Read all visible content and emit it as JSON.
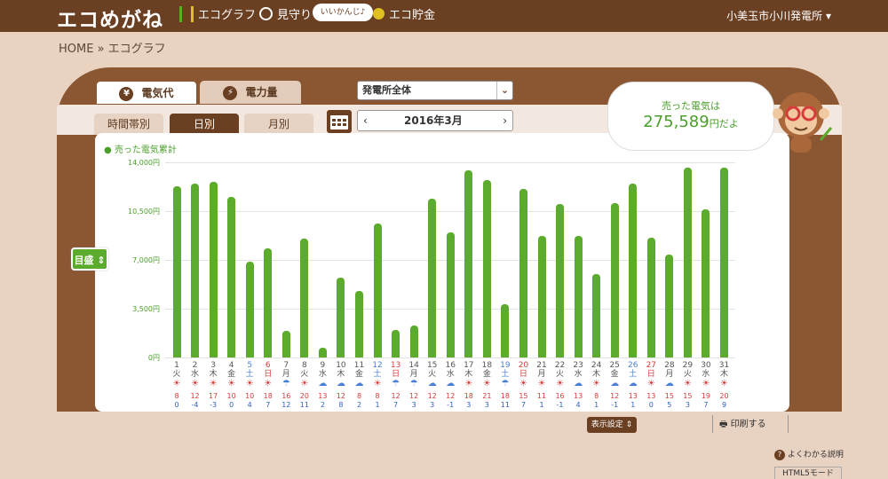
{
  "header": {
    "logo": "エコめがね",
    "nav": [
      "エコグラフ",
      "見守り",
      "エコ貯金"
    ],
    "bubble": "いいかんじ♪",
    "location": "小美玉市小川発電所 ▾"
  },
  "breadcrumb": "HOME » エコグラフ",
  "tabs": {
    "money": "電気代",
    "power": "電力量",
    "money_icon": "¥",
    "power_icon": "⚡"
  },
  "plant_select": "発電所全体",
  "subtabs": [
    "時間帯別",
    "日別",
    "月別"
  ],
  "month_label": "2016年3月",
  "savings": {
    "label": "売った電気は",
    "value": "275,589",
    "suffix": "円だよ"
  },
  "legend": "売った電気累計",
  "scale_button": "目盛 ⇕",
  "display_settings": "表示設定 ⇕",
  "print": "印刷する",
  "help": "よくわかる説明",
  "html5": "HTML5モード",
  "colors": {
    "bar": "#5bab2c",
    "header": "#6b3f22",
    "sunday": "#d93b3b",
    "saturday": "#4a80d8"
  },
  "chart_data": {
    "type": "bar",
    "title": "",
    "ylabel": "",
    "ylim": [
      0,
      14000
    ],
    "yticks": [
      "0円",
      "3,500円",
      "7,000円",
      "10,500円",
      "14,000円"
    ],
    "categories": [
      "1",
      "2",
      "3",
      "4",
      "5",
      "6",
      "7",
      "8",
      "9",
      "10",
      "11",
      "12",
      "13",
      "14",
      "15",
      "16",
      "17",
      "18",
      "19",
      "20",
      "21",
      "22",
      "23",
      "24",
      "25",
      "26",
      "27",
      "28",
      "29",
      "30",
      "31"
    ],
    "weekdays": [
      "火",
      "水",
      "木",
      "金",
      "土",
      "日",
      "月",
      "火",
      "水",
      "木",
      "金",
      "土",
      "日",
      "月",
      "火",
      "水",
      "木",
      "金",
      "土",
      "日",
      "月",
      "火",
      "水",
      "木",
      "金",
      "土",
      "日",
      "月",
      "火",
      "水",
      "木"
    ],
    "values": [
      12300,
      12500,
      12600,
      11500,
      6900,
      7800,
      1900,
      8500,
      700,
      5700,
      4800,
      9600,
      2000,
      2300,
      11400,
      9000,
      13400,
      12700,
      3800,
      12100,
      8700,
      11000,
      8700,
      6000,
      11100,
      12500,
      8600,
      7400,
      13600,
      10600,
      13600
    ],
    "weather": [
      "sun",
      "sun",
      "sun",
      "sun",
      "sun",
      "sun",
      "rain",
      "sun",
      "cloud",
      "cloud",
      "cloud",
      "sun",
      "rain",
      "rain",
      "cloud",
      "cloud",
      "sun",
      "sun",
      "rain",
      "sun",
      "sun",
      "sun",
      "cloud",
      "sun",
      "cloud",
      "cloud",
      "sun",
      "cloud",
      "sun",
      "sun",
      "sun"
    ],
    "high": [
      "8",
      "12",
      "17",
      "10",
      "10",
      "18",
      "16",
      "20",
      "13",
      "12",
      "8",
      "8",
      "12",
      "12",
      "12",
      "12",
      "18",
      "21",
      "18",
      "15",
      "11",
      "16",
      "13",
      "8",
      "12",
      "13",
      "13",
      "15",
      "15",
      "19",
      "20"
    ],
    "low": [
      "0",
      "-4",
      "-3",
      "0",
      "4",
      "7",
      "12",
      "11",
      "2",
      "8",
      "2",
      "1",
      "7",
      "3",
      "3",
      "-1",
      "3",
      "3",
      "11",
      "7",
      "1",
      "-1",
      "4",
      "1",
      "-1",
      "1",
      "0",
      "5",
      "3",
      "7",
      "9"
    ]
  }
}
